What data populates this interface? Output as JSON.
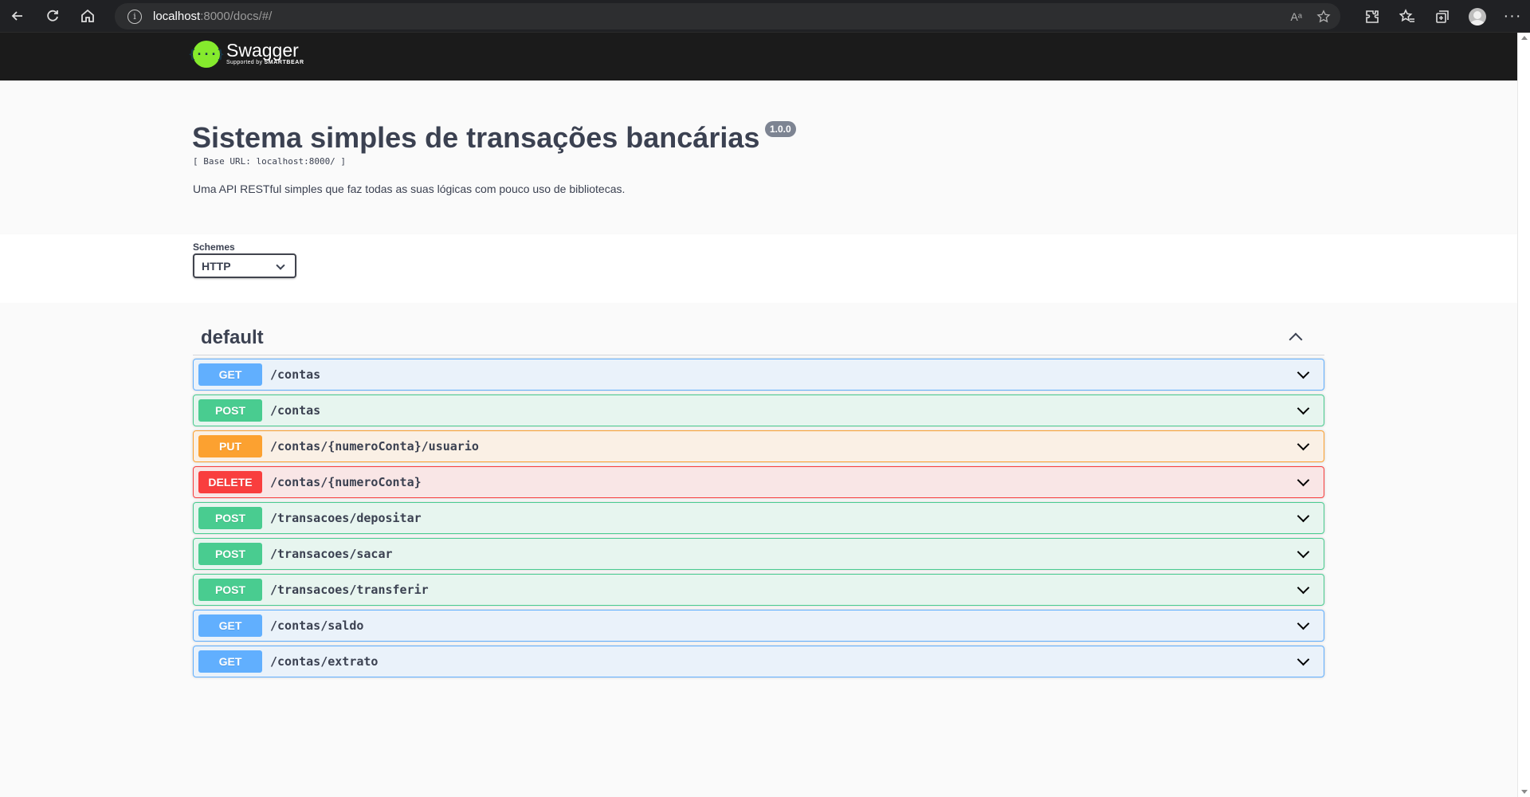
{
  "browser": {
    "url_host": "localhost",
    "url_rest": ":8000/docs/#/",
    "read_aloud_label": "Aᵃ"
  },
  "swagger": {
    "logo_mark": "{···}",
    "logo_title": "Swagger",
    "logo_supported_by": "Supported by",
    "logo_brand": "SMARTBEAR"
  },
  "info": {
    "title": "Sistema simples de transações bancárias",
    "version": "1.0.0",
    "base_url": "[ Base URL: localhost:8000/ ]",
    "description": "Uma API RESTful simples que faz todas as suas lógicas com pouco uso de bibliotecas."
  },
  "schemes": {
    "label": "Schemes",
    "selected": "HTTP"
  },
  "tag": {
    "name": "default"
  },
  "operations": [
    {
      "method": "GET",
      "path": "/contas"
    },
    {
      "method": "POST",
      "path": "/contas"
    },
    {
      "method": "PUT",
      "path": "/contas/{numeroConta}/usuario"
    },
    {
      "method": "DELETE",
      "path": "/contas/{numeroConta}"
    },
    {
      "method": "POST",
      "path": "/transacoes/depositar"
    },
    {
      "method": "POST",
      "path": "/transacoes/sacar"
    },
    {
      "method": "POST",
      "path": "/transacoes/transferir"
    },
    {
      "method": "GET",
      "path": "/contas/saldo"
    },
    {
      "method": "GET",
      "path": "/contas/extrato"
    }
  ],
  "colors": {
    "get": "#61affe",
    "post": "#49cc90",
    "put": "#fca130",
    "delete": "#f93e3e",
    "swagger_green": "#85ea2d",
    "topbar": "#1b1b1b"
  }
}
